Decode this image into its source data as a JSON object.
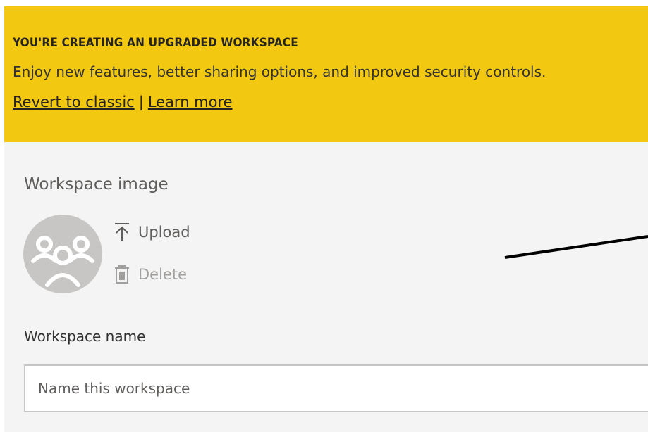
{
  "banner": {
    "title": "YOU'RE CREATING AN UPGRADED WORKSPACE",
    "subtitle": "Enjoy new features, better sharing options, and improved security controls.",
    "revert_link": "Revert to classic",
    "separator": "|",
    "learn_more_link": "Learn more",
    "background_color": "#f2c811"
  },
  "workspace_image": {
    "label": "Workspace image",
    "avatar_icon": "group-people-icon",
    "upload_label": "Upload",
    "upload_icon": "upload-arrow-icon",
    "delete_label": "Delete",
    "delete_icon": "trash-icon"
  },
  "workspace_name": {
    "label": "Workspace name",
    "placeholder": "Name this workspace",
    "value": ""
  }
}
